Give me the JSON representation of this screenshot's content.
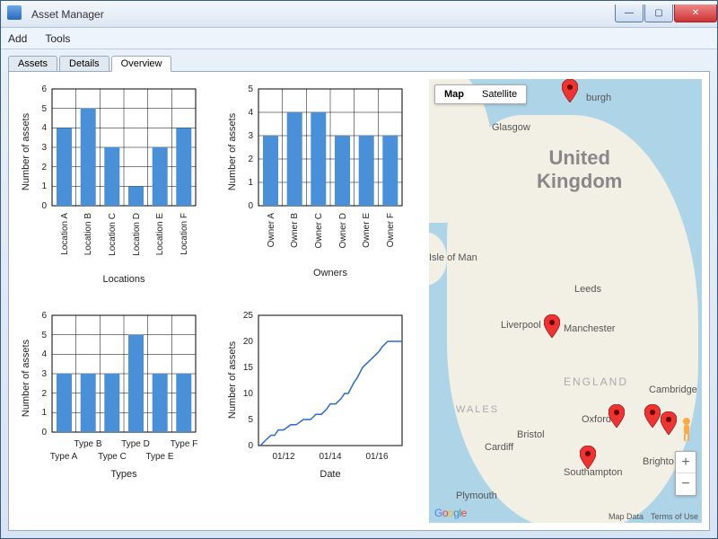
{
  "window": {
    "title": "Asset Manager"
  },
  "menu": {
    "add": "Add",
    "tools": "Tools"
  },
  "tabs": {
    "assets": "Assets",
    "details": "Details",
    "overview": "Overview",
    "active": "overview"
  },
  "charts": {
    "locations": {
      "ylabel": "Number of assets",
      "xlabel": "Locations"
    },
    "owners": {
      "ylabel": "Number of assets",
      "xlabel": "Owners"
    },
    "types": {
      "ylabel": "Number of assets",
      "xlabel": "Types"
    },
    "date": {
      "ylabel": "Number of assets",
      "xlabel": "Date"
    }
  },
  "map": {
    "type_map": "Map",
    "type_sat": "Satellite",
    "country": "United\nKingdom",
    "cities": {
      "glasgow": "Glasgow",
      "edinburgh": "burgh",
      "isle": "Isle of Man",
      "leeds": "Leeds",
      "liverpool": "Liverpool",
      "manchester": "Manchester",
      "england": "ENGLAND",
      "wales": "WALES",
      "cambridge": "Cambridge",
      "oxford": "Oxford",
      "bristol": "Bristol",
      "cardiff": "Cardiff",
      "southampton": "Southampton",
      "brighton": "Brighto",
      "plymouth": "Plymouth"
    },
    "footer": {
      "google": "Google",
      "mapdata": "Map Data",
      "terms": "Terms of Use"
    }
  },
  "chart_data": [
    {
      "type": "bar",
      "title": "",
      "xlabel": "Locations",
      "ylabel": "Number of assets",
      "ylim": [
        0,
        6
      ],
      "categories": [
        "Location A",
        "Location B",
        "Location C",
        "Location D",
        "Location E",
        "Location F"
      ],
      "values": [
        4,
        5,
        3,
        1,
        3,
        4
      ]
    },
    {
      "type": "bar",
      "title": "",
      "xlabel": "Owners",
      "ylabel": "Number of assets",
      "ylim": [
        0,
        5
      ],
      "categories": [
        "Owner A",
        "Owner B",
        "Owner C",
        "Owner D",
        "Owner E",
        "Owner F"
      ],
      "values": [
        3,
        4,
        4,
        3,
        3,
        3
      ]
    },
    {
      "type": "bar",
      "title": "",
      "xlabel": "Types",
      "ylabel": "Number of assets",
      "ylim": [
        0,
        6
      ],
      "categories": [
        "Type A",
        "Type B",
        "Type C",
        "Type D",
        "Type E",
        "Type F"
      ],
      "values": [
        3,
        3,
        3,
        5,
        3,
        3
      ]
    },
    {
      "type": "line",
      "title": "",
      "xlabel": "Date",
      "ylabel": "Number of assets",
      "ylim": [
        0,
        25
      ],
      "xticks": [
        "01/12",
        "01/14",
        "01/16"
      ],
      "series": [
        {
          "name": "cumulative",
          "x": [
            "06/11",
            "09/11",
            "11/11",
            "12/11",
            "03/12",
            "06/12",
            "12/12",
            "04/13",
            "09/13",
            "12/13",
            "03/14",
            "06/14",
            "08/14",
            "10/14",
            "01/15",
            "04/15",
            "07/15",
            "10/15",
            "01/16",
            "04/16",
            "07/16",
            "10/16",
            "01/17"
          ],
          "values": [
            0,
            1,
            2,
            3,
            3,
            4,
            5,
            6,
            7,
            8,
            9,
            9,
            10,
            10,
            12,
            13,
            15,
            17,
            18,
            19,
            20,
            20,
            20
          ]
        }
      ]
    }
  ]
}
